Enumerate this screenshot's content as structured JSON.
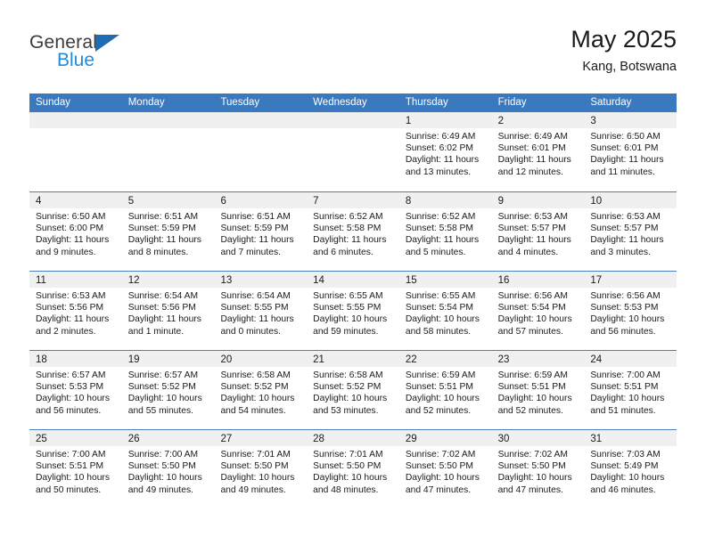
{
  "brand": {
    "word1": "General",
    "word2": "Blue",
    "triangle_color": "#1f6cb5",
    "blue_text_color": "#1f8ae0"
  },
  "header": {
    "title": "May 2025",
    "subtitle": "Kang, Botswana"
  },
  "theme": {
    "header_blue": "#3a79bd",
    "row_divider": "#4a80c0",
    "daynum_band": "#f0f0f0",
    "text": "#1a1a1a"
  },
  "weekdays": [
    "Sunday",
    "Monday",
    "Tuesday",
    "Wednesday",
    "Thursday",
    "Friday",
    "Saturday"
  ],
  "weeks": [
    [
      {
        "day": "",
        "lines": []
      },
      {
        "day": "",
        "lines": []
      },
      {
        "day": "",
        "lines": []
      },
      {
        "day": "",
        "lines": []
      },
      {
        "day": "1",
        "lines": [
          "Sunrise: 6:49 AM",
          "Sunset: 6:02 PM",
          "Daylight: 11 hours",
          "and 13 minutes."
        ]
      },
      {
        "day": "2",
        "lines": [
          "Sunrise: 6:49 AM",
          "Sunset: 6:01 PM",
          "Daylight: 11 hours",
          "and 12 minutes."
        ]
      },
      {
        "day": "3",
        "lines": [
          "Sunrise: 6:50 AM",
          "Sunset: 6:01 PM",
          "Daylight: 11 hours",
          "and 11 minutes."
        ]
      }
    ],
    [
      {
        "day": "4",
        "lines": [
          "Sunrise: 6:50 AM",
          "Sunset: 6:00 PM",
          "Daylight: 11 hours",
          "and 9 minutes."
        ]
      },
      {
        "day": "5",
        "lines": [
          "Sunrise: 6:51 AM",
          "Sunset: 5:59 PM",
          "Daylight: 11 hours",
          "and 8 minutes."
        ]
      },
      {
        "day": "6",
        "lines": [
          "Sunrise: 6:51 AM",
          "Sunset: 5:59 PM",
          "Daylight: 11 hours",
          "and 7 minutes."
        ]
      },
      {
        "day": "7",
        "lines": [
          "Sunrise: 6:52 AM",
          "Sunset: 5:58 PM",
          "Daylight: 11 hours",
          "and 6 minutes."
        ]
      },
      {
        "day": "8",
        "lines": [
          "Sunrise: 6:52 AM",
          "Sunset: 5:58 PM",
          "Daylight: 11 hours",
          "and 5 minutes."
        ]
      },
      {
        "day": "9",
        "lines": [
          "Sunrise: 6:53 AM",
          "Sunset: 5:57 PM",
          "Daylight: 11 hours",
          "and 4 minutes."
        ]
      },
      {
        "day": "10",
        "lines": [
          "Sunrise: 6:53 AM",
          "Sunset: 5:57 PM",
          "Daylight: 11 hours",
          "and 3 minutes."
        ]
      }
    ],
    [
      {
        "day": "11",
        "lines": [
          "Sunrise: 6:53 AM",
          "Sunset: 5:56 PM",
          "Daylight: 11 hours",
          "and 2 minutes."
        ]
      },
      {
        "day": "12",
        "lines": [
          "Sunrise: 6:54 AM",
          "Sunset: 5:56 PM",
          "Daylight: 11 hours",
          "and 1 minute."
        ]
      },
      {
        "day": "13",
        "lines": [
          "Sunrise: 6:54 AM",
          "Sunset: 5:55 PM",
          "Daylight: 11 hours",
          "and 0 minutes."
        ]
      },
      {
        "day": "14",
        "lines": [
          "Sunrise: 6:55 AM",
          "Sunset: 5:55 PM",
          "Daylight: 10 hours",
          "and 59 minutes."
        ]
      },
      {
        "day": "15",
        "lines": [
          "Sunrise: 6:55 AM",
          "Sunset: 5:54 PM",
          "Daylight: 10 hours",
          "and 58 minutes."
        ]
      },
      {
        "day": "16",
        "lines": [
          "Sunrise: 6:56 AM",
          "Sunset: 5:54 PM",
          "Daylight: 10 hours",
          "and 57 minutes."
        ]
      },
      {
        "day": "17",
        "lines": [
          "Sunrise: 6:56 AM",
          "Sunset: 5:53 PM",
          "Daylight: 10 hours",
          "and 56 minutes."
        ]
      }
    ],
    [
      {
        "day": "18",
        "lines": [
          "Sunrise: 6:57 AM",
          "Sunset: 5:53 PM",
          "Daylight: 10 hours",
          "and 56 minutes."
        ]
      },
      {
        "day": "19",
        "lines": [
          "Sunrise: 6:57 AM",
          "Sunset: 5:52 PM",
          "Daylight: 10 hours",
          "and 55 minutes."
        ]
      },
      {
        "day": "20",
        "lines": [
          "Sunrise: 6:58 AM",
          "Sunset: 5:52 PM",
          "Daylight: 10 hours",
          "and 54 minutes."
        ]
      },
      {
        "day": "21",
        "lines": [
          "Sunrise: 6:58 AM",
          "Sunset: 5:52 PM",
          "Daylight: 10 hours",
          "and 53 minutes."
        ]
      },
      {
        "day": "22",
        "lines": [
          "Sunrise: 6:59 AM",
          "Sunset: 5:51 PM",
          "Daylight: 10 hours",
          "and 52 minutes."
        ]
      },
      {
        "day": "23",
        "lines": [
          "Sunrise: 6:59 AM",
          "Sunset: 5:51 PM",
          "Daylight: 10 hours",
          "and 52 minutes."
        ]
      },
      {
        "day": "24",
        "lines": [
          "Sunrise: 7:00 AM",
          "Sunset: 5:51 PM",
          "Daylight: 10 hours",
          "and 51 minutes."
        ]
      }
    ],
    [
      {
        "day": "25",
        "lines": [
          "Sunrise: 7:00 AM",
          "Sunset: 5:51 PM",
          "Daylight: 10 hours",
          "and 50 minutes."
        ]
      },
      {
        "day": "26",
        "lines": [
          "Sunrise: 7:00 AM",
          "Sunset: 5:50 PM",
          "Daylight: 10 hours",
          "and 49 minutes."
        ]
      },
      {
        "day": "27",
        "lines": [
          "Sunrise: 7:01 AM",
          "Sunset: 5:50 PM",
          "Daylight: 10 hours",
          "and 49 minutes."
        ]
      },
      {
        "day": "28",
        "lines": [
          "Sunrise: 7:01 AM",
          "Sunset: 5:50 PM",
          "Daylight: 10 hours",
          "and 48 minutes."
        ]
      },
      {
        "day": "29",
        "lines": [
          "Sunrise: 7:02 AM",
          "Sunset: 5:50 PM",
          "Daylight: 10 hours",
          "and 47 minutes."
        ]
      },
      {
        "day": "30",
        "lines": [
          "Sunrise: 7:02 AM",
          "Sunset: 5:50 PM",
          "Daylight: 10 hours",
          "and 47 minutes."
        ]
      },
      {
        "day": "31",
        "lines": [
          "Sunrise: 7:03 AM",
          "Sunset: 5:49 PM",
          "Daylight: 10 hours",
          "and 46 minutes."
        ]
      }
    ]
  ]
}
